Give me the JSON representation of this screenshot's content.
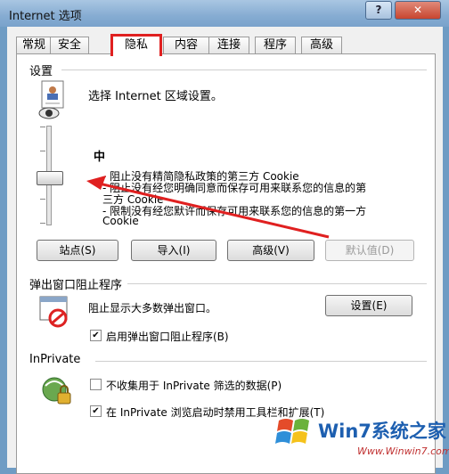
{
  "window": {
    "title": "Internet 选项",
    "help_label": "?",
    "close_label": "✕"
  },
  "tabs": [
    "常规",
    "安全",
    "隐私",
    "内容",
    "连接",
    "程序",
    "高级"
  ],
  "settings": {
    "group_label": "设置",
    "description": "选择 Internet 区域设置。",
    "level": "中",
    "bullets": [
      "- 阻止没有精简隐私政策的第三方 Cookie",
      "- 阻止没有经您明确同意而保存可用来联系您的信息的第",
      "三方 Cookie",
      "- 限制没有经您默许而保存可用来联系您的信息的第一方",
      "Cookie"
    ],
    "buttons": [
      "站点(S)",
      "导入(I)",
      "高级(V)",
      "默认值(D)"
    ]
  },
  "popup": {
    "group_label": "弹出窗口阻止程序",
    "description": "阻止显示大多数弹出窗口。",
    "settings_button": "设置(E)",
    "enable_label": "启用弹出窗口阻止程序(B)",
    "enable_checked": true
  },
  "inprivate": {
    "group_label": "InPrivate",
    "no_collect_label": "不收集用于 InPrivate 筛选的数据(P)",
    "no_collect_checked": false,
    "disable_toolbars_label": "在 InPrivate 浏览启动时禁用工具栏和扩展(T)",
    "disable_toolbars_checked": true
  },
  "watermark": {
    "brand": "Win7系统之家",
    "url": "Www.Winwin7.com"
  }
}
